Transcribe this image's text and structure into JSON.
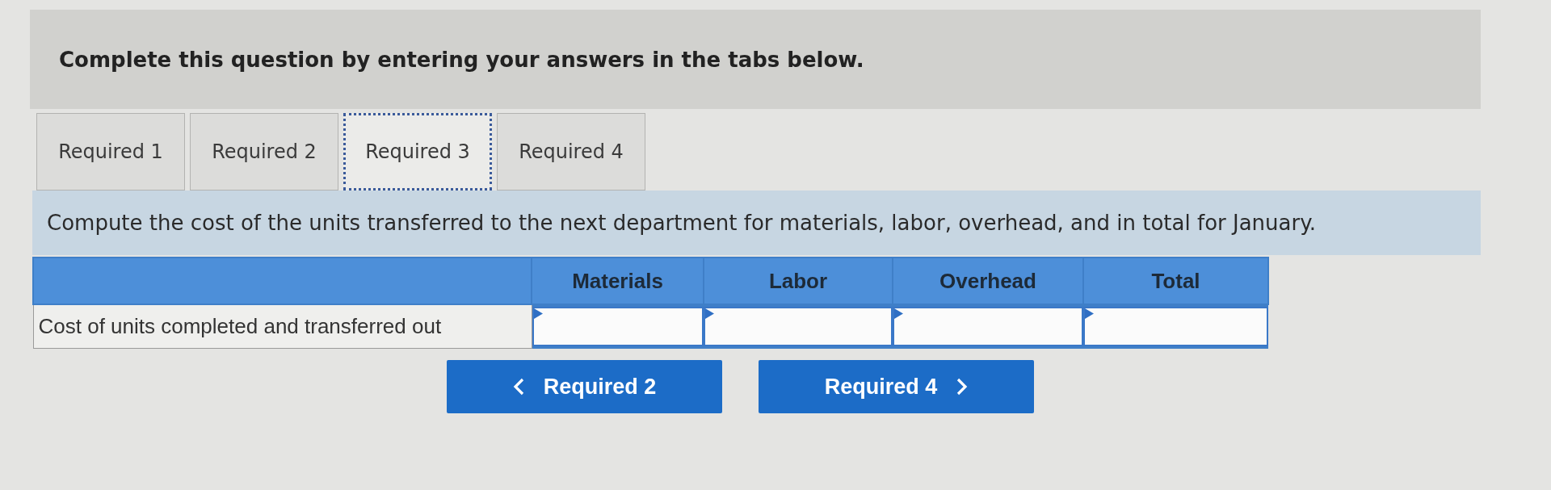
{
  "banner": {
    "text": "Complete this question by entering your answers in the tabs below."
  },
  "tabs": [
    {
      "label": "Required 1",
      "selected": false
    },
    {
      "label": "Required 2",
      "selected": false
    },
    {
      "label": "Required 3",
      "selected": true
    },
    {
      "label": "Required 4",
      "selected": false
    }
  ],
  "instruction": "Compute the cost of the units transferred to the next department for materials, labor, overhead, and in total for January.",
  "table": {
    "columns": [
      "Materials",
      "Labor",
      "Overhead",
      "Total"
    ],
    "rows": [
      {
        "label": "Cost of units completed and transferred out"
      }
    ]
  },
  "nav_buttons": [
    {
      "label": "Required 2",
      "kind": "prev"
    },
    {
      "label": "Required 4",
      "kind": "next"
    }
  ]
}
